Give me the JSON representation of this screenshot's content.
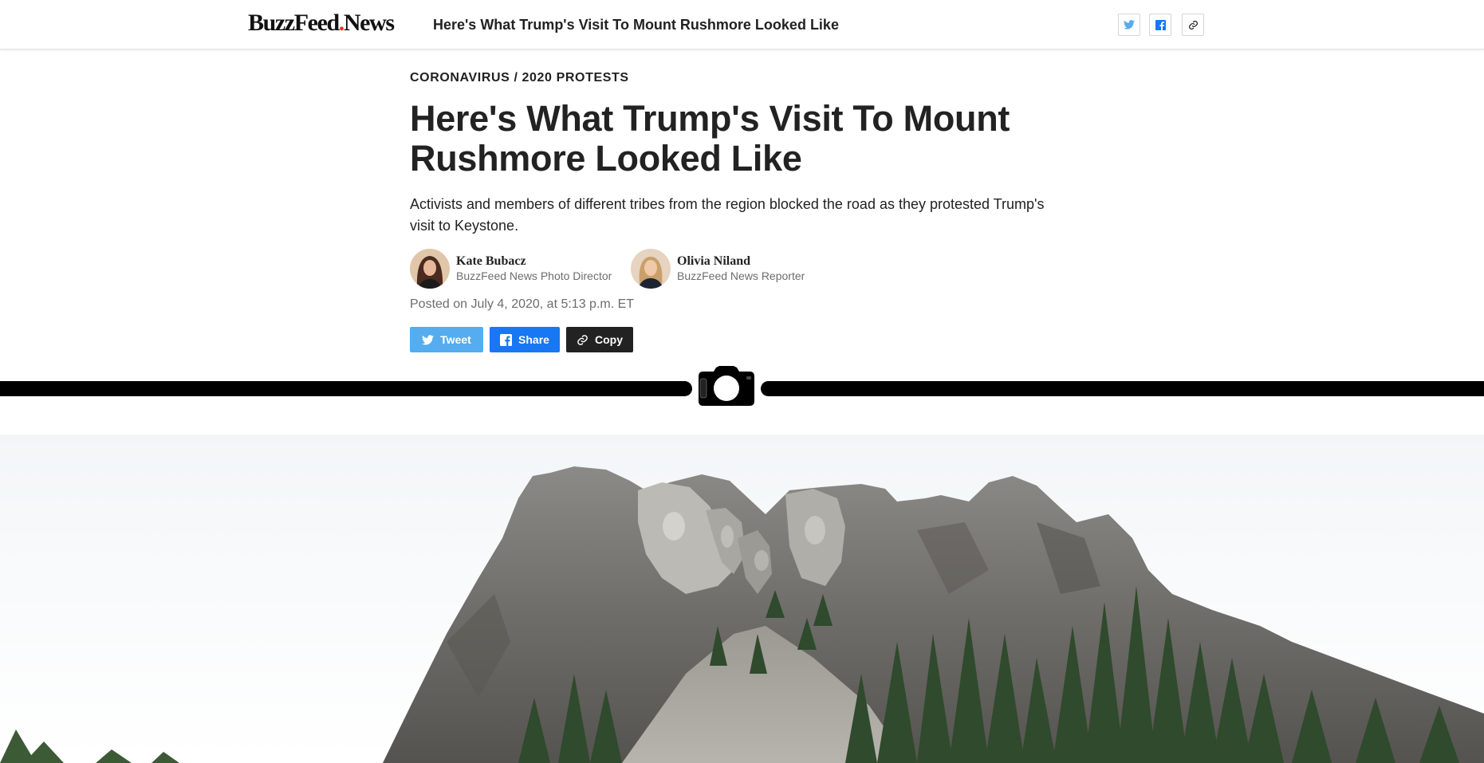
{
  "header": {
    "logo_main": "BuzzFeed",
    "logo_dot": ".",
    "logo_suffix": "News",
    "title": "Here's What Trump's Visit To Mount Rushmore Looked Like",
    "share_icons": [
      "twitter-icon",
      "facebook-icon",
      "link-icon"
    ]
  },
  "article": {
    "kicker": "CORONAVIRUS / 2020 PROTESTS",
    "headline": "Here's What Trump's Visit To Mount Rushmore Looked Like",
    "dek": "Activists and members of different tribes from the region blocked the road as they protested Trump's visit to Keystone.",
    "authors": [
      {
        "name": "Kate Bubacz",
        "role": "BuzzFeed News Photo Director"
      },
      {
        "name": "Olivia Niland",
        "role": "BuzzFeed News Reporter"
      }
    ],
    "timestamp": "Posted on July 4, 2020, at 5:13 p.m. ET",
    "share_buttons": [
      {
        "label": "Tweet",
        "icon": "twitter-icon",
        "color": "#55acee"
      },
      {
        "label": "Share",
        "icon": "facebook-icon",
        "color": "#1877f2"
      },
      {
        "label": "Copy",
        "icon": "link-icon",
        "color": "#222222"
      }
    ]
  },
  "divider": {
    "icon": "camera-icon"
  },
  "hero": {
    "subject": "Mount Rushmore photo"
  },
  "colors": {
    "brand_red": "#ee3322",
    "text": "#222222",
    "muted": "#6d6d6d",
    "twitter": "#55acee",
    "facebook": "#1877f2"
  }
}
